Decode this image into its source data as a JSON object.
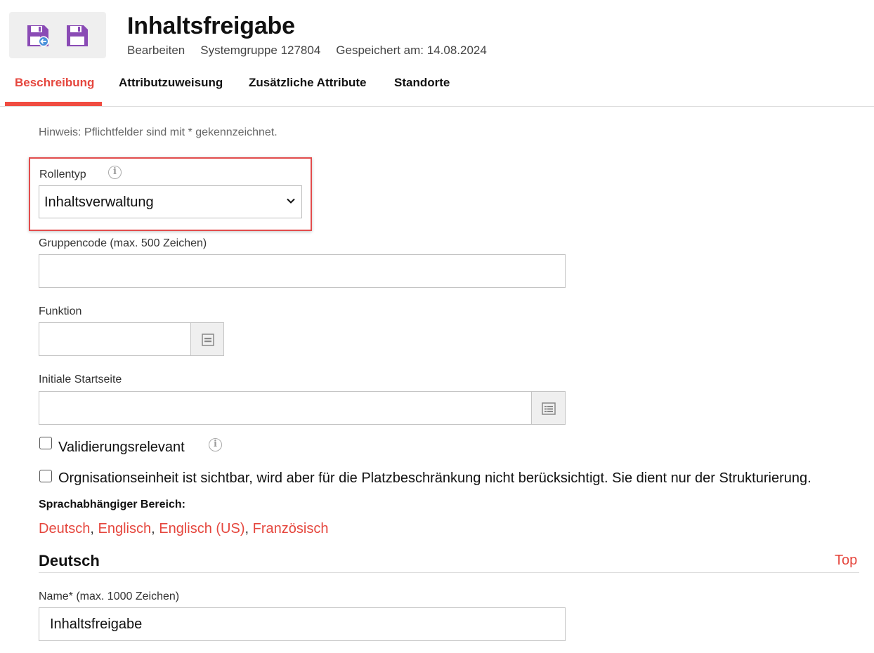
{
  "header": {
    "title": "Inhaltsfreigabe",
    "meta": [
      "Bearbeiten",
      "Systemgruppe 127804",
      "Gespeichert am: 14.08.2024"
    ],
    "icon_color": "#8a4bb5"
  },
  "tabs": [
    {
      "label": "Beschreibung",
      "active": true
    },
    {
      "label": "Attributzuweisung",
      "active": false
    },
    {
      "label": "Zusätzliche Attribute",
      "active": false
    },
    {
      "label": "Standorte",
      "active": false
    }
  ],
  "form": {
    "hint": "Hinweis: Pflichtfelder sind mit * gekennzeichnet.",
    "rollentyp": {
      "label": "Rollentyp",
      "value": "Inhaltsverwaltung"
    },
    "gruppencode": {
      "label": "Gruppencode (max. 500 Zeichen)",
      "value": ""
    },
    "funktion": {
      "label": "Funktion",
      "value": ""
    },
    "startseite": {
      "label": "Initiale Startseite",
      "value": ""
    },
    "validierung": {
      "label": "Validierungsrelevant",
      "checked": false
    },
    "orgeinheit": {
      "label": "Orgnisationseinheit ist sichtbar, wird aber für die Platzbeschränkung nicht berücksichtigt. Sie dient nur der Strukturierung.",
      "checked": false
    },
    "sprach_label": "Sprachabhängiger Bereich:",
    "languages": [
      "Deutsch",
      "Englisch",
      "Englisch (US)",
      "Französisch"
    ],
    "section_title": "Deutsch",
    "top_link": "Top",
    "name": {
      "label": "Name* (max. 1000 Zeichen)",
      "value": "Inhaltsfreigabe"
    }
  },
  "colors": {
    "accent": "#f04c41",
    "highlight": "#e24c4c"
  }
}
